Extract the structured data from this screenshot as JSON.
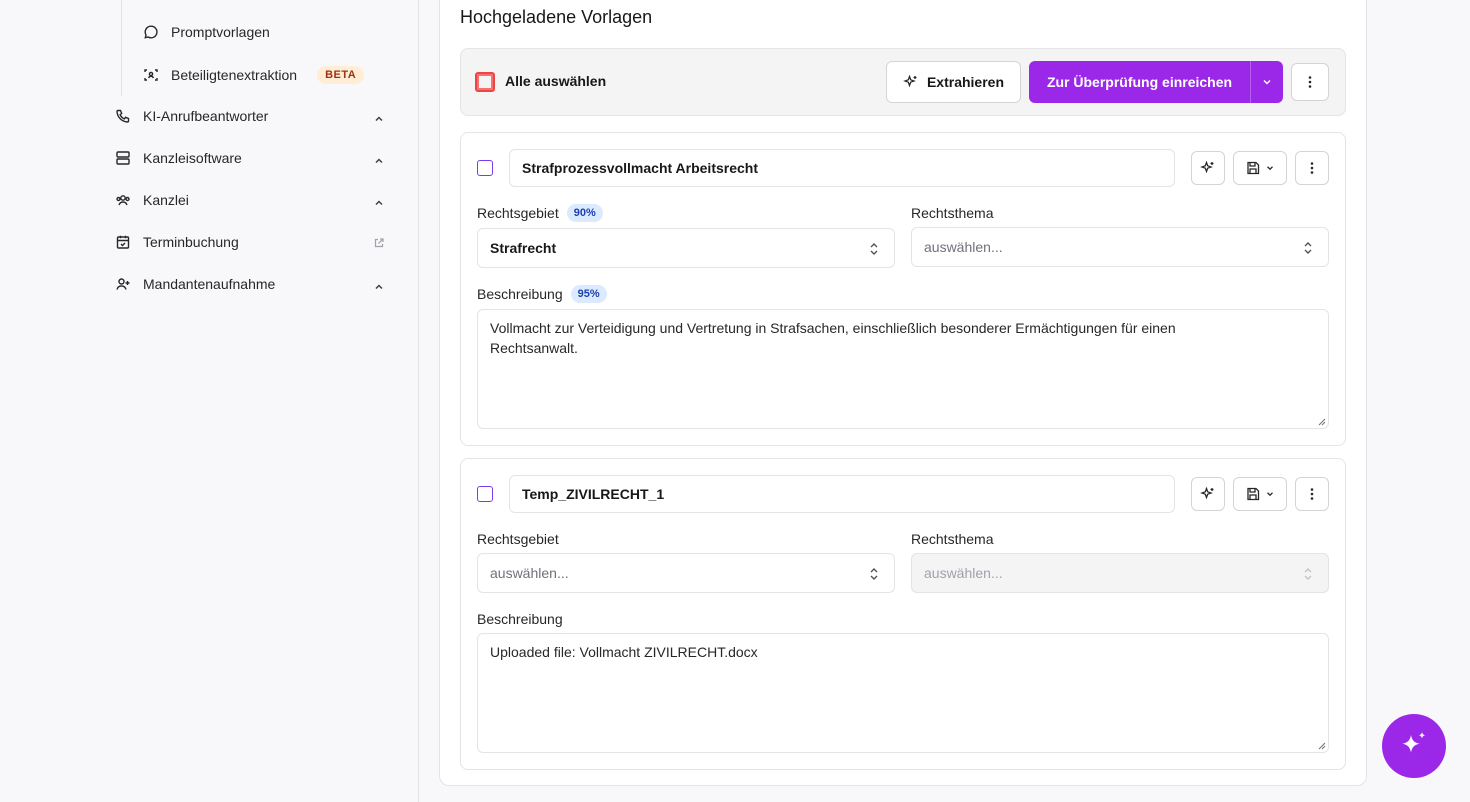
{
  "sidebar": {
    "sub_items": [
      {
        "label": "Promptvorlagen",
        "icon": "chat-bubble-icon"
      },
      {
        "label": "Beteiligtenextraktion",
        "icon": "scan-person-icon",
        "badge": "BETA"
      }
    ],
    "items": [
      {
        "label": "KI-Anrufbeantworter",
        "icon": "phone-icon"
      },
      {
        "label": "Kanzleisoftware",
        "icon": "server-icon"
      },
      {
        "label": "Kanzlei",
        "icon": "users-icon"
      },
      {
        "label": "Terminbuchung",
        "icon": "calendar-check-icon"
      },
      {
        "label": "Mandantenaufnahme",
        "icon": "user-plus-icon"
      }
    ]
  },
  "section": {
    "title": "Hochgeladene Vorlagen"
  },
  "toolbar": {
    "select_all_label": "Alle auswählen",
    "extract_label": "Extrahieren",
    "submit_label": "Zur Überprüfung einreichen"
  },
  "templates": [
    {
      "name": "Strafprozessvollmacht Arbeitsrecht",
      "rechtsgebiet_label": "Rechtsgebiet",
      "rechtsgebiet_confidence": "90%",
      "rechtsgebiet_value": "Strafrecht",
      "rechtsthema_label": "Rechtsthema",
      "rechtsthema_placeholder": "auswählen...",
      "beschreibung_label": "Beschreibung",
      "beschreibung_confidence": "95%",
      "beschreibung_line1": "Vollmacht zur Verteidigung und Vertretung in Strafsachen, einschließlich besonderer Ermächtigungen für einen",
      "beschreibung_line2": "Rechtsanwalt."
    },
    {
      "name": "Temp_ZIVILRECHT_1",
      "rechtsgebiet_label": "Rechtsgebiet",
      "rechtsgebiet_placeholder": "auswählen...",
      "rechtsthema_label": "Rechtsthema",
      "rechtsthema_placeholder": "auswählen...",
      "beschreibung_label": "Beschreibung",
      "beschreibung_text": "Uploaded file: Vollmacht ZIVILRECHT.docx"
    }
  ],
  "colors": {
    "accent": "#9b27e8",
    "confidence_bg": "#dbeafe",
    "beta_bg": "#ffedd5"
  }
}
